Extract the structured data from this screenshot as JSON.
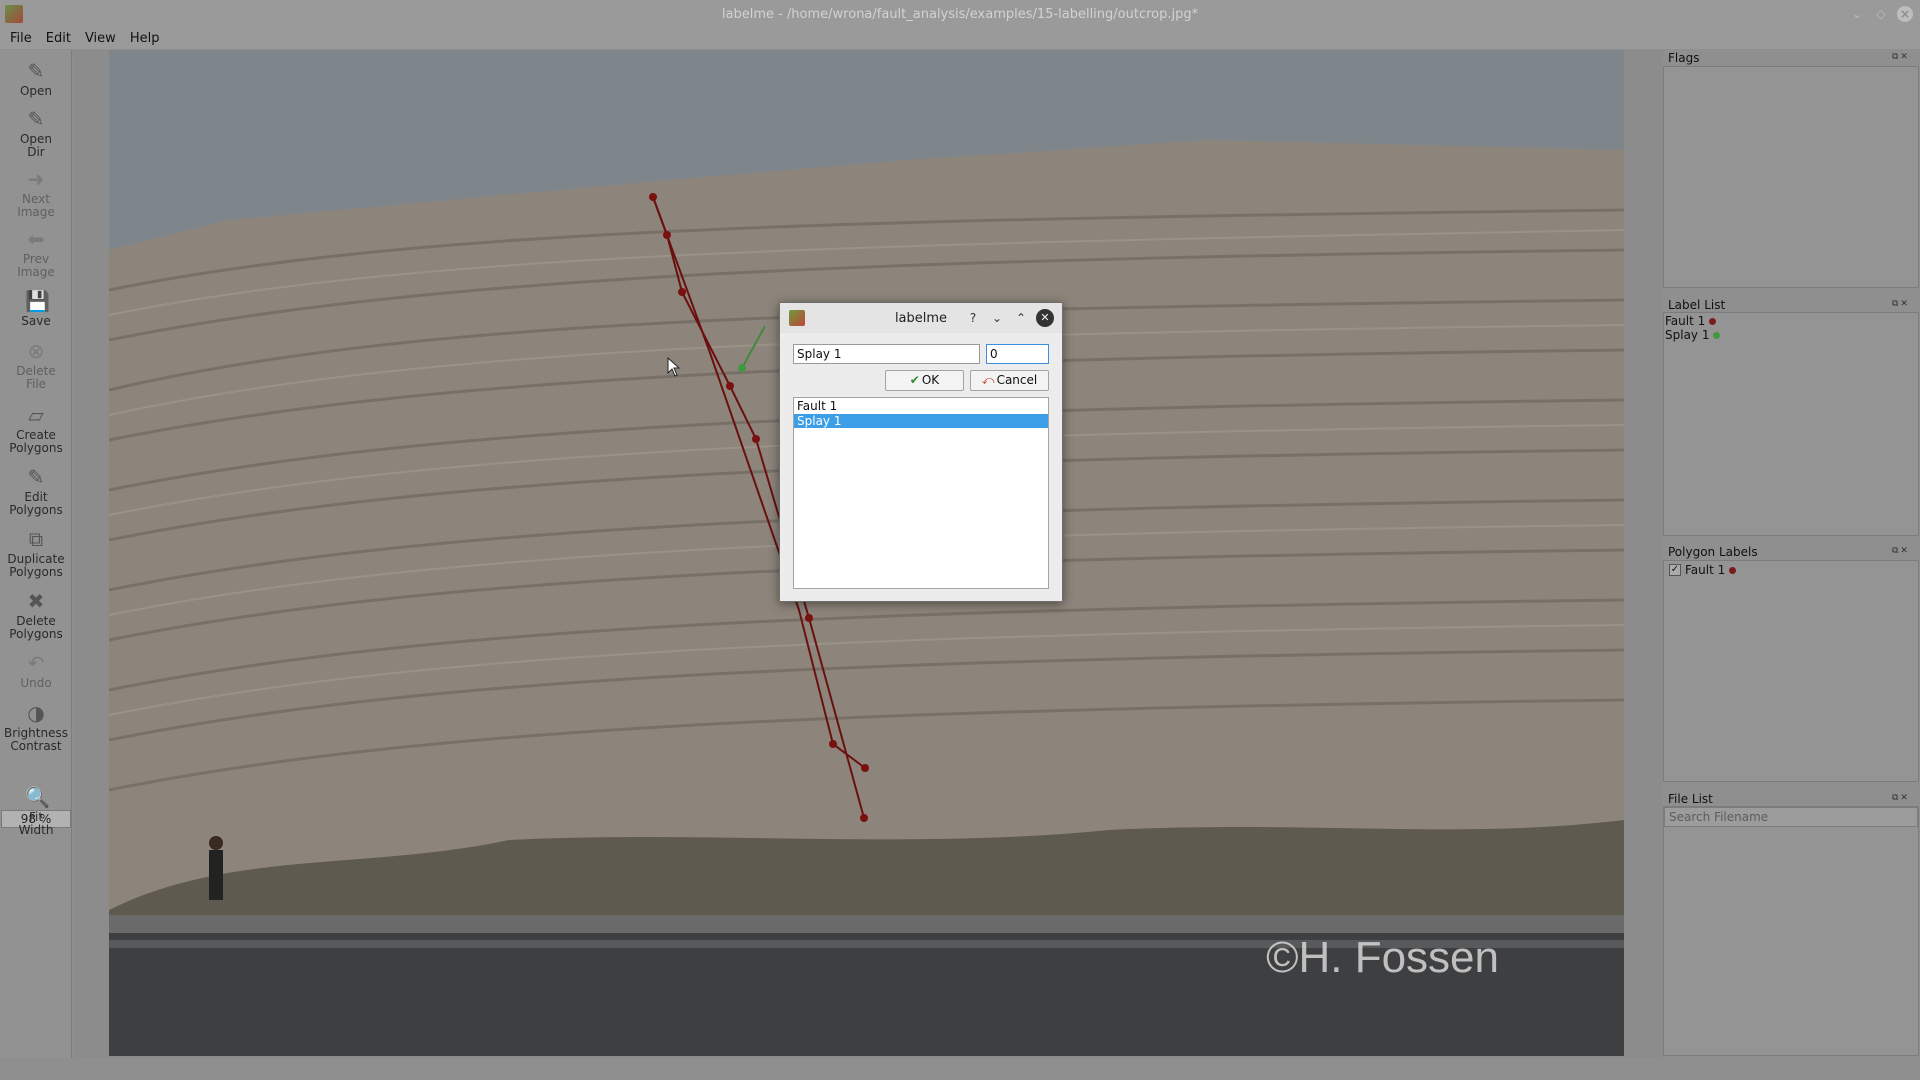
{
  "window": {
    "title": "labelme - /home/wrona/fault_analysis/examples/15-labelling/outcrop.jpg*"
  },
  "menu": [
    "File",
    "Edit",
    "View",
    "Help"
  ],
  "toolbar": {
    "open": "Open",
    "open_dir": [
      "Open",
      "Dir"
    ],
    "next_image": [
      "Next",
      "Image"
    ],
    "prev_image": [
      "Prev",
      "Image"
    ],
    "save": "Save",
    "delete_file": [
      "Delete",
      "File"
    ],
    "create_polygons": [
      "Create",
      "Polygons"
    ],
    "edit_polygons": [
      "Edit",
      "Polygons"
    ],
    "duplicate_polygons": [
      "Duplicate",
      "Polygons"
    ],
    "delete_polygons": [
      "Delete",
      "Polygons"
    ],
    "undo": "Undo",
    "brightness_contrast": [
      "Brightness",
      "Contrast"
    ],
    "zoom": "98 %",
    "fit_width": [
      "Fit",
      "Width"
    ]
  },
  "canvas": {
    "watermark": "©H. Fossen"
  },
  "panels": {
    "flags": {
      "title": "Flags"
    },
    "label_list": {
      "title": "Label List",
      "items": [
        {
          "label": "Fault 1",
          "color": "#7a1c1c"
        },
        {
          "label": "Splay 1",
          "color": "#3f9a3f"
        }
      ]
    },
    "polygon_labels": {
      "title": "Polygon Labels",
      "items": [
        {
          "label": "Fault 1",
          "checked": "✓",
          "color": "#7a1c1c"
        }
      ]
    },
    "file_list": {
      "title": "File List",
      "search_placeholder": "Search Filename"
    }
  },
  "dialog": {
    "title": "labelme",
    "help": "?",
    "label_value": "Splay 1",
    "group_id_value": "0",
    "ok": "OK",
    "cancel": "Cancel",
    "labels": [
      "Fault 1",
      "Splay 1"
    ],
    "selected": "Splay 1"
  }
}
